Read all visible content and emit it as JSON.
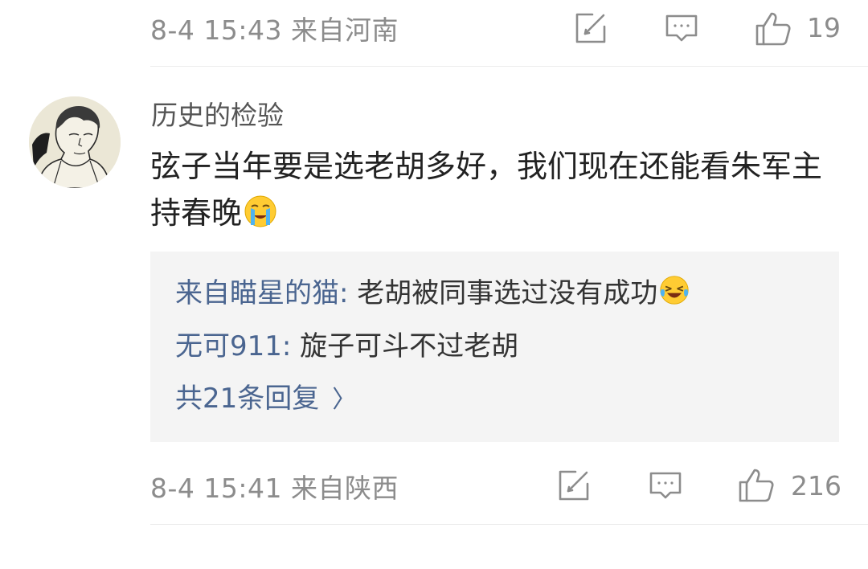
{
  "top_meta": {
    "time_location": "8-4 15:43 来自河南",
    "likes": "19",
    "icons": [
      "edit-icon",
      "comment-icon",
      "thumbs-up-icon"
    ]
  },
  "comment": {
    "username": "历史的检验",
    "text": "弦子当年要是选老胡多好，我们现在还能看朱军主持春晚",
    "emoji": "crying-emoji",
    "replies": [
      {
        "name": "来自瞄星的猫",
        "sep": ":",
        "text": " 老胡被同事选过没有成功",
        "emoji": "laughing-crying-emoji"
      },
      {
        "name": "无可911",
        "sep": ":",
        "text": " 旋子可斗不过老胡"
      }
    ],
    "more_replies": "共21条回复",
    "meta": {
      "time_location": "8-4 15:41 来自陕西",
      "likes": "216"
    }
  },
  "colors": {
    "link_blue": "#4a6590",
    "meta_gray": "#8c8c8c",
    "reply_bg": "#f4f4f4"
  }
}
